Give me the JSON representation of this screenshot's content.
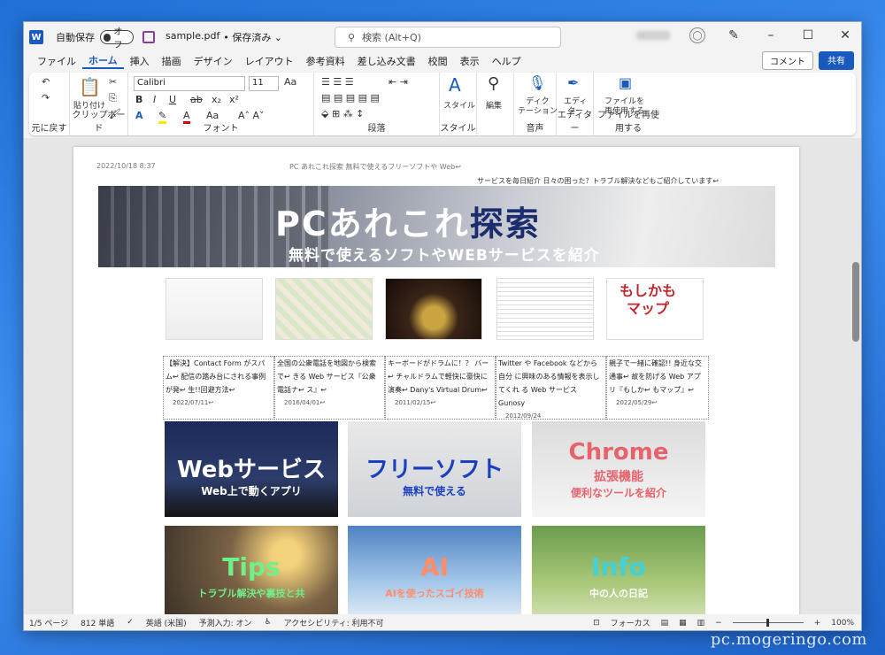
{
  "titlebar": {
    "autosave_label": "自動保存",
    "toggle_state": "オフ",
    "filename": "sample.pdf",
    "save_state": "• 保存済み ⌄",
    "search_placeholder": "検索 (Alt+Q)"
  },
  "tabs": [
    "ファイル",
    "ホーム",
    "挿入",
    "描画",
    "デザイン",
    "レイアウト",
    "参考資料",
    "差し込み文書",
    "校閲",
    "表示",
    "ヘルプ"
  ],
  "active_tab": "ホーム",
  "actions": {
    "comment": "コメント",
    "share": "共有"
  },
  "ribbon": {
    "groups": [
      "元に戻す",
      "クリップボード",
      "フォント",
      "段落",
      "スタイル",
      "音声",
      "エディター",
      "ファイルを再使用する"
    ],
    "paste": "貼り付け",
    "font_name": "Calibri",
    "font_size": "11",
    "style_label": "スタイル",
    "edit_label": "編集",
    "dictation": "ディク\nテーション",
    "editor": "エディ\nター",
    "reuse": "ファイルを\n再使用する"
  },
  "document": {
    "header_date": "2022/10/18 8:37",
    "header_title": "PC あれこれ探索 無料で使えるフリーソフトや Web↩",
    "subtitle": "サービスを毎日紹介 日々の困った？トラブル解決などもご紹介しています↩",
    "banner_title_a": "PCあれこれ",
    "banner_title_b": "探索",
    "banner_sub": "無料で使えるソフトやWEBサービスを紹介",
    "mapthumb": "もしかも\nマップ",
    "articles": [
      {
        "text": "【解決】Contact Form がスパム↩ 配信の踏み台にされる事例が発↩ 生!!回避方法↩",
        "date": "2022/07/11↩"
      },
      {
        "text": "全国の公衆電話を地図から検索で↩ きる Web サービス『公衆電話ナ↩ ス』↩",
        "date": "2016/04/01↩"
      },
      {
        "text": "キーボードがドラムに！？ バー↩ チャルドラムで軽快に豪快に演奏↩ Dany's Virtual Drum↩",
        "date": "2011/02/15↩"
      },
      {
        "text": "Twitter や Facebook などから自分 に興味のある情報を表示してくれ る Web サービス Gunosy",
        "date": "2012/09/24"
      },
      {
        "text": "親子で一緒に確認!! 身近な交通事↩ 故を防げる Web アプリ『もしか↩ もマップ』↩",
        "date": "2022/05/29↩"
      }
    ],
    "tiles": [
      {
        "title": "Webサービス",
        "sub": "Web上で動くアプリ"
      },
      {
        "title": "フリーソフト",
        "sub": "無料で使える"
      },
      {
        "title": "Chrome",
        "sub": "拡張機能",
        "sub2": "便利なツールを紹介"
      },
      {
        "title": "Tips",
        "sub": "トラブル解決や裏技と共"
      },
      {
        "title": "AI",
        "sub": "AIを使ったスゴイ技術"
      },
      {
        "title": "Info",
        "sub": "中の人の日記"
      }
    ]
  },
  "status": {
    "page": "1/5 ページ",
    "words": "812 単語",
    "lang": "英語 (米国)",
    "predict": "予測入力: オン",
    "access": "アクセシビリティ: 利用不可",
    "focus": "フォーカス",
    "zoom": "100%"
  },
  "watermark": "pc.mogeringo.com"
}
